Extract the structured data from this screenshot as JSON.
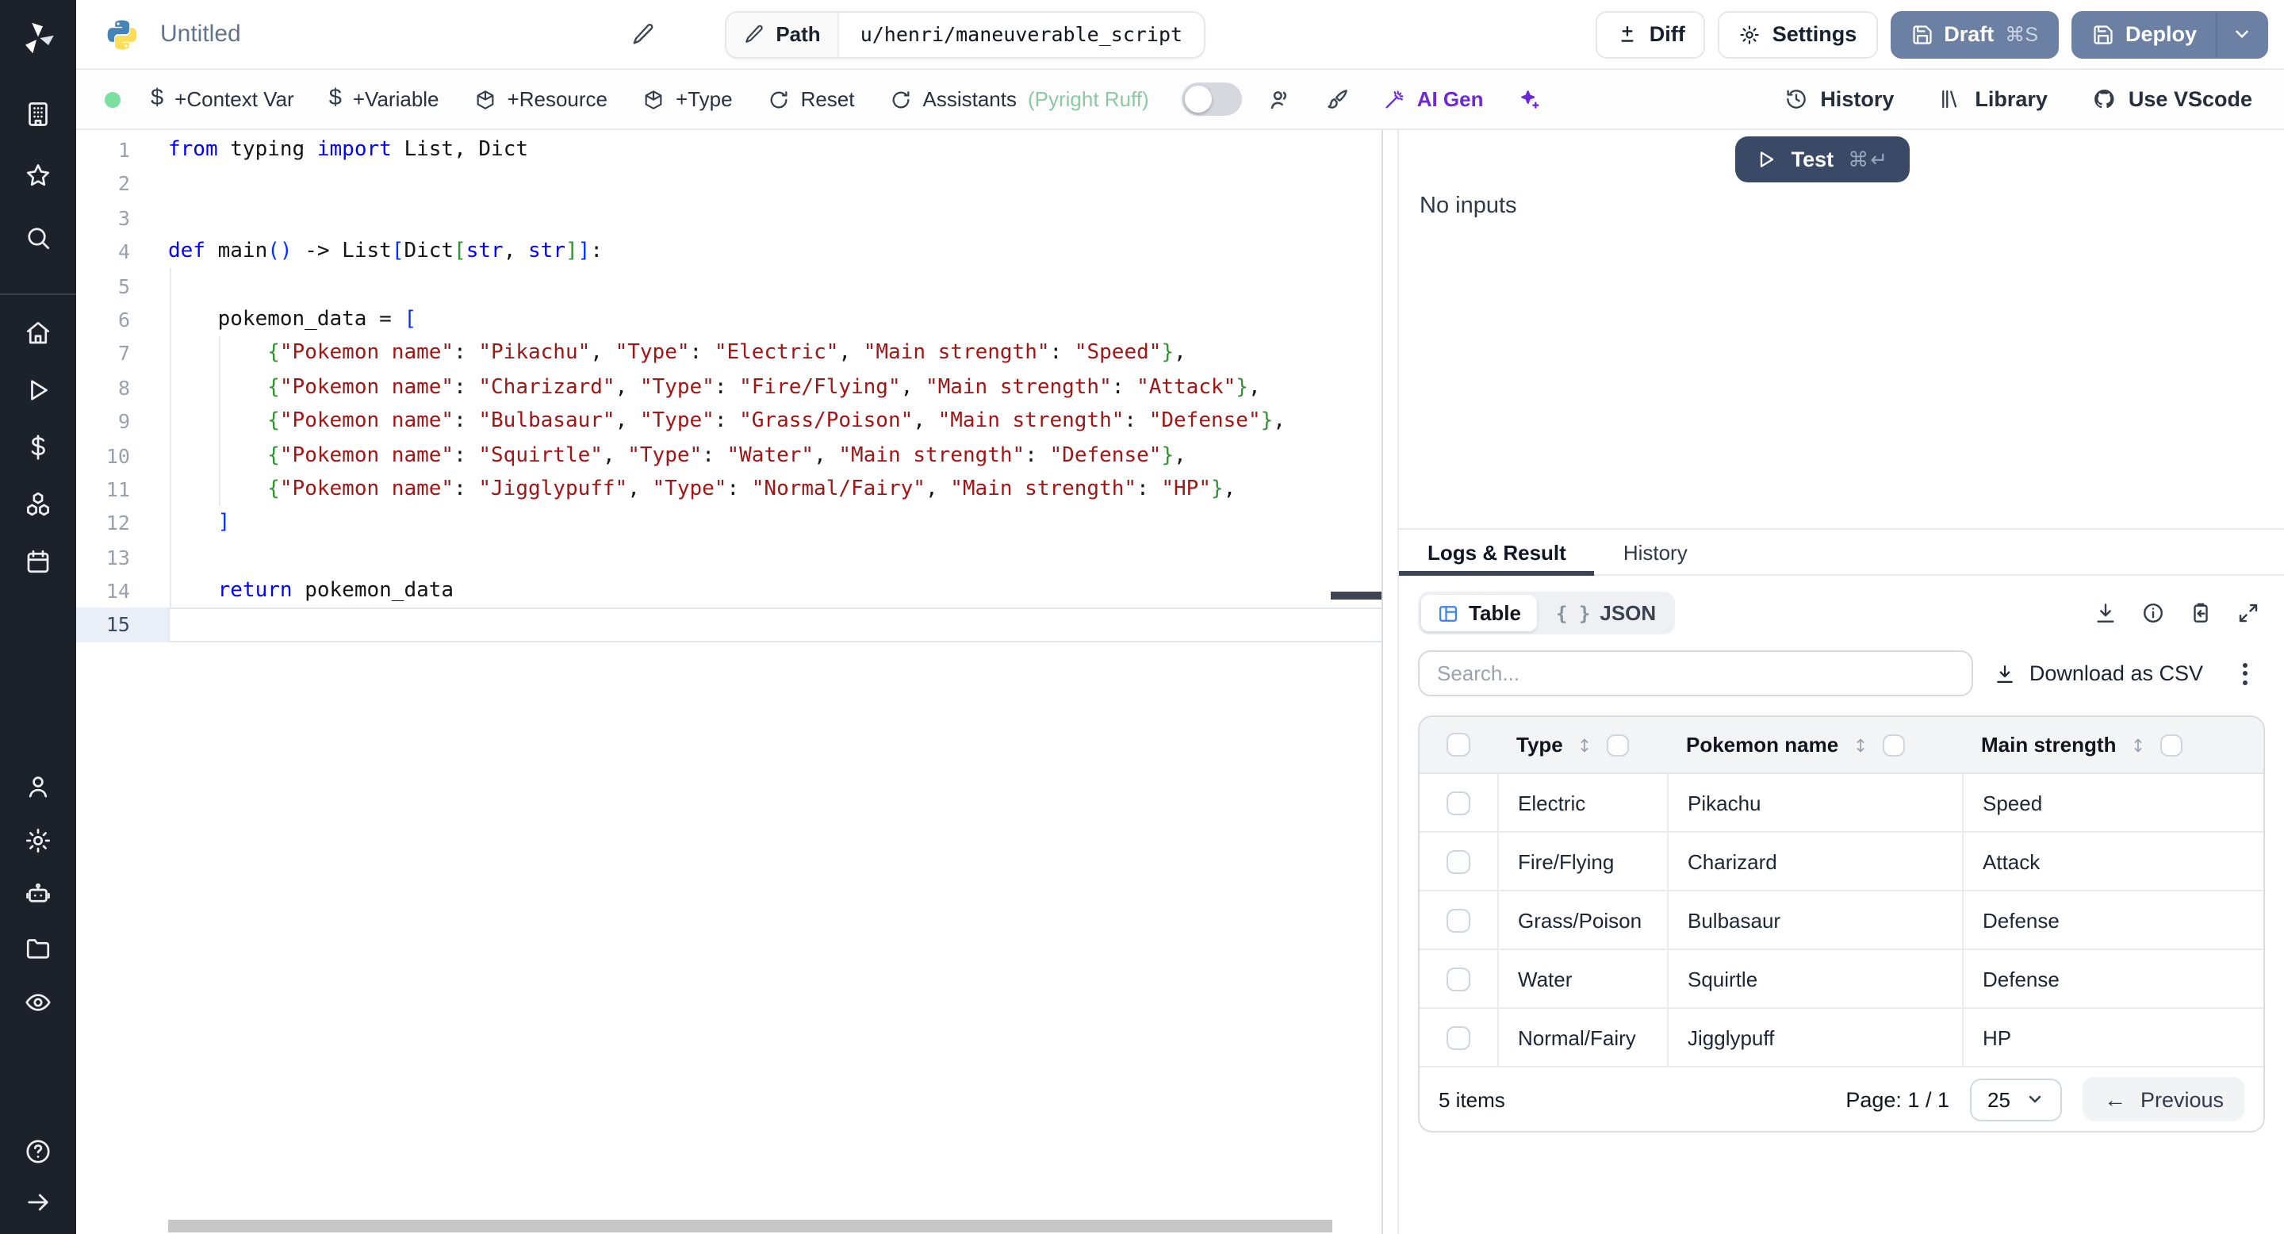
{
  "topbar": {
    "title": "Untitled",
    "path": {
      "label": "Path",
      "value": "u/henri/maneuverable_script"
    },
    "buttons": {
      "diff": "Diff",
      "settings": "Settings",
      "draft": "Draft",
      "draft_shortcut": "⌘S",
      "deploy": "Deploy"
    }
  },
  "toolbar": {
    "status_color": "#7ce0a3",
    "context_var": "+Context Var",
    "variable": "+Variable",
    "resource": "+Resource",
    "type": "+Type",
    "reset": "Reset",
    "assistants": "Assistants",
    "assistants_detail": "(Pyright Ruff)",
    "assistants_detail_color": "#8cc9a2",
    "ai_gen": "AI Gen",
    "ai_color": "#6d28d9",
    "history": "History",
    "library": "Library",
    "vscode": "Use VScode"
  },
  "sidebar": {
    "top": [
      "building",
      "star",
      "search"
    ],
    "main": [
      "home",
      "play",
      "dollar",
      "cubes",
      "calendar"
    ],
    "lower": [
      "user",
      "gear",
      "robot",
      "folder",
      "eye"
    ],
    "bottom": [
      "help",
      "arrow-right"
    ]
  },
  "editor": {
    "language": "python",
    "current_line": 15,
    "colors": {
      "keyword": "#0000ff",
      "string": "#a31515",
      "bracket_blue": "#0431fa",
      "bracket_green": "#319331"
    },
    "lines": [
      {
        "n": 1,
        "segs": [
          [
            "k",
            "from"
          ],
          [
            "p",
            " typing "
          ],
          [
            "k",
            "import"
          ],
          [
            "p",
            " List, Dict"
          ]
        ]
      },
      {
        "n": 2,
        "segs": []
      },
      {
        "n": 3,
        "segs": []
      },
      {
        "n": 4,
        "segs": [
          [
            "k",
            "def"
          ],
          [
            "p",
            " main"
          ],
          [
            "bb",
            "()"
          ],
          [
            "p",
            " -> List"
          ],
          [
            "bb",
            "["
          ],
          [
            "p",
            "Dict"
          ],
          [
            "bg",
            "["
          ],
          [
            "k",
            "str"
          ],
          [
            "p",
            ", "
          ],
          [
            "k",
            "str"
          ],
          [
            "bg",
            "]"
          ],
          [
            "bb",
            "]"
          ],
          [
            "p",
            ":"
          ]
        ]
      },
      {
        "n": 5,
        "segs": []
      },
      {
        "n": 6,
        "segs": [
          [
            "p",
            "    pokemon_data = "
          ],
          [
            "bb",
            "["
          ]
        ]
      },
      {
        "n": 7,
        "segs": [
          [
            "p",
            "        "
          ],
          [
            "bg",
            "{"
          ],
          [
            "s",
            "\"Pokemon name\""
          ],
          [
            "p",
            ": "
          ],
          [
            "s",
            "\"Pikachu\""
          ],
          [
            "p",
            ", "
          ],
          [
            "s",
            "\"Type\""
          ],
          [
            "p",
            ": "
          ],
          [
            "s",
            "\"Electric\""
          ],
          [
            "p",
            ", "
          ],
          [
            "s",
            "\"Main strength\""
          ],
          [
            "p",
            ": "
          ],
          [
            "s",
            "\"Speed\""
          ],
          [
            "bg",
            "}"
          ],
          [
            "p",
            ","
          ]
        ]
      },
      {
        "n": 8,
        "segs": [
          [
            "p",
            "        "
          ],
          [
            "bg",
            "{"
          ],
          [
            "s",
            "\"Pokemon name\""
          ],
          [
            "p",
            ": "
          ],
          [
            "s",
            "\"Charizard\""
          ],
          [
            "p",
            ", "
          ],
          [
            "s",
            "\"Type\""
          ],
          [
            "p",
            ": "
          ],
          [
            "s",
            "\"Fire/Flying\""
          ],
          [
            "p",
            ", "
          ],
          [
            "s",
            "\"Main strength\""
          ],
          [
            "p",
            ": "
          ],
          [
            "s",
            "\"Attack\""
          ],
          [
            "bg",
            "}"
          ],
          [
            "p",
            ","
          ]
        ]
      },
      {
        "n": 9,
        "segs": [
          [
            "p",
            "        "
          ],
          [
            "bg",
            "{"
          ],
          [
            "s",
            "\"Pokemon name\""
          ],
          [
            "p",
            ": "
          ],
          [
            "s",
            "\"Bulbasaur\""
          ],
          [
            "p",
            ", "
          ],
          [
            "s",
            "\"Type\""
          ],
          [
            "p",
            ": "
          ],
          [
            "s",
            "\"Grass/Poison\""
          ],
          [
            "p",
            ", "
          ],
          [
            "s",
            "\"Main strength\""
          ],
          [
            "p",
            ": "
          ],
          [
            "s",
            "\"Defense\""
          ],
          [
            "bg",
            "}"
          ],
          [
            "p",
            ","
          ]
        ]
      },
      {
        "n": 10,
        "segs": [
          [
            "p",
            "        "
          ],
          [
            "bg",
            "{"
          ],
          [
            "s",
            "\"Pokemon name\""
          ],
          [
            "p",
            ": "
          ],
          [
            "s",
            "\"Squirtle\""
          ],
          [
            "p",
            ", "
          ],
          [
            "s",
            "\"Type\""
          ],
          [
            "p",
            ": "
          ],
          [
            "s",
            "\"Water\""
          ],
          [
            "p",
            ", "
          ],
          [
            "s",
            "\"Main strength\""
          ],
          [
            "p",
            ": "
          ],
          [
            "s",
            "\"Defense\""
          ],
          [
            "bg",
            "}"
          ],
          [
            "p",
            ","
          ]
        ]
      },
      {
        "n": 11,
        "segs": [
          [
            "p",
            "        "
          ],
          [
            "bg",
            "{"
          ],
          [
            "s",
            "\"Pokemon name\""
          ],
          [
            "p",
            ": "
          ],
          [
            "s",
            "\"Jigglypuff\""
          ],
          [
            "p",
            ", "
          ],
          [
            "s",
            "\"Type\""
          ],
          [
            "p",
            ": "
          ],
          [
            "s",
            "\"Normal/Fairy\""
          ],
          [
            "p",
            ", "
          ],
          [
            "s",
            "\"Main strength\""
          ],
          [
            "p",
            ": "
          ],
          [
            "s",
            "\"HP\""
          ],
          [
            "bg",
            "}"
          ],
          [
            "p",
            ","
          ]
        ]
      },
      {
        "n": 12,
        "segs": [
          [
            "p",
            "    "
          ],
          [
            "bb",
            "]"
          ]
        ]
      },
      {
        "n": 13,
        "segs": []
      },
      {
        "n": 14,
        "segs": [
          [
            "p",
            "    "
          ],
          [
            "k",
            "return"
          ],
          [
            "p",
            " pokemon_data"
          ]
        ]
      },
      {
        "n": 15,
        "segs": []
      }
    ]
  },
  "run_panel": {
    "test": "Test",
    "shortcut": "⌘↵",
    "no_inputs": "No inputs",
    "test_color": "#3a4a66"
  },
  "result_panel": {
    "tabs": [
      {
        "label": "Logs & Result"
      },
      {
        "label": "History"
      }
    ],
    "view_toggle": {
      "table": "Table",
      "json": "JSON",
      "braces": "{ }"
    },
    "search_placeholder": "Search...",
    "download_csv": "Download as CSV",
    "table": {
      "columns": [
        "Type",
        "Pokemon name",
        "Main strength"
      ],
      "rows": [
        [
          "Electric",
          "Pikachu",
          "Speed"
        ],
        [
          "Fire/Flying",
          "Charizard",
          "Attack"
        ],
        [
          "Grass/Poison",
          "Bulbasaur",
          "Defense"
        ],
        [
          "Water",
          "Squirtle",
          "Defense"
        ],
        [
          "Normal/Fairy",
          "Jigglypuff",
          "HP"
        ]
      ],
      "footer": {
        "count": "5 items",
        "page": "Page: 1 / 1",
        "page_size": "25",
        "previous": "Previous"
      }
    }
  }
}
